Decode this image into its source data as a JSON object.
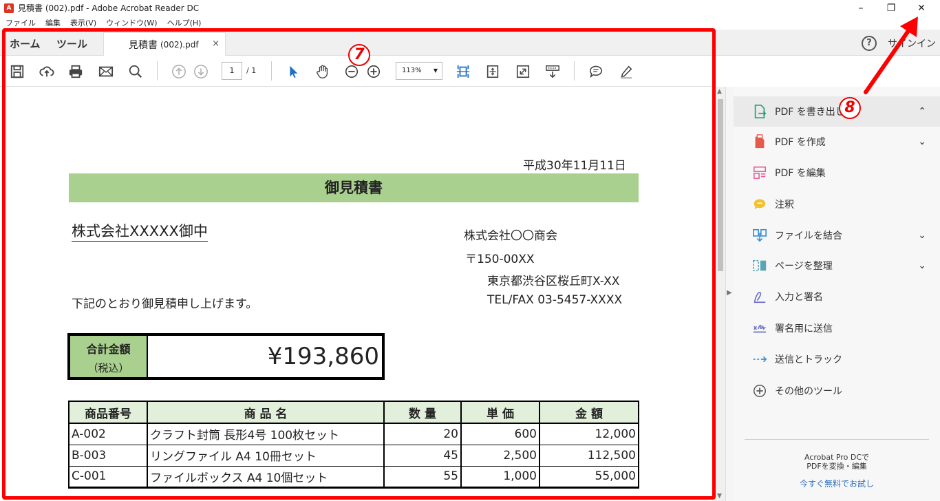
{
  "window": {
    "title": "見積書 (002).pdf - Adobe Acrobat Reader DC",
    "icon": "pdf-icon",
    "minimize": "–",
    "restore": "❐",
    "close": "✕"
  },
  "menu": [
    "ファイル",
    "編集",
    "表示(V)",
    "ウィンドウ(W)",
    "ヘルプ(H)"
  ],
  "tabs": {
    "home": "ホーム",
    "tools": "ツール",
    "doc_name": "見積書",
    "doc_suffix": "(002).pdf",
    "close": "×"
  },
  "header_right": {
    "help": "?",
    "signin": "サインイン"
  },
  "toolbar": {
    "page_current": "1",
    "page_total": "/ 1",
    "zoom": "113%",
    "zoom_caret": "▼"
  },
  "document": {
    "date": "平成30年11月11日",
    "title": "御見積書",
    "customer": "株式会社XXXXX御中",
    "company": "株式会社〇〇商会",
    "postal": "〒150-00XX",
    "address": "東京都渋谷区桜丘町X-XX",
    "tel": "TEL/FAX 03-5457-XXXX",
    "intro": "下記のとおり御見積申し上げます。",
    "total_label": "合計金額",
    "total_sub": "（税込）",
    "total_value": "¥193,860",
    "table": {
      "headers": [
        "商品番号",
        "商 品 名",
        "数 量",
        "単 価",
        "金 額"
      ],
      "rows": [
        [
          "A-002",
          "クラフト封筒 長形4号 100枚セット",
          "20",
          "600",
          "12,000"
        ],
        [
          "B-003",
          "リングファイル A4 10冊セット",
          "45",
          "2,500",
          "112,500"
        ],
        [
          "C-001",
          "ファイルボックス A4 10個セット",
          "55",
          "1,000",
          "55,000"
        ]
      ]
    }
  },
  "sidebar": {
    "items": [
      {
        "label": "PDF を書き出し",
        "icon": "export-pdf-icon",
        "chevron": "⌃",
        "color": "#2a9d6e"
      },
      {
        "label": "PDF を作成",
        "icon": "create-pdf-icon",
        "chevron": "⌄",
        "color": "#e45b4b"
      },
      {
        "label": "PDF を編集",
        "icon": "edit-pdf-icon",
        "chevron": "",
        "color": "#e4639a"
      },
      {
        "label": "注釈",
        "icon": "comment-icon",
        "chevron": "",
        "color": "#f2c12e"
      },
      {
        "label": "ファイルを結合",
        "icon": "combine-files-icon",
        "chevron": "⌄",
        "color": "#3a8fd6"
      },
      {
        "label": "ページを整理",
        "icon": "organize-pages-icon",
        "chevron": "⌄",
        "color": "#5aa6b8"
      },
      {
        "label": "入力と署名",
        "icon": "fill-sign-icon",
        "chevron": "",
        "color": "#6d6dc8"
      },
      {
        "label": "署名用に送信",
        "icon": "send-signature-icon",
        "chevron": "",
        "color": "#6d6dc8"
      },
      {
        "label": "送信とトラック",
        "icon": "send-track-icon",
        "chevron": "",
        "color": "#3a8fd6"
      },
      {
        "label": "その他のツール",
        "icon": "more-tools-icon",
        "chevron": "",
        "color": "#555555"
      }
    ],
    "promo_line1": "Acrobat Pro DCで",
    "promo_line2": "PDFを変換・編集",
    "promo_link": "今すぐ無料でお試し"
  },
  "annotations": {
    "badge7": "7",
    "badge8": "8",
    "color": "#ff0000"
  }
}
